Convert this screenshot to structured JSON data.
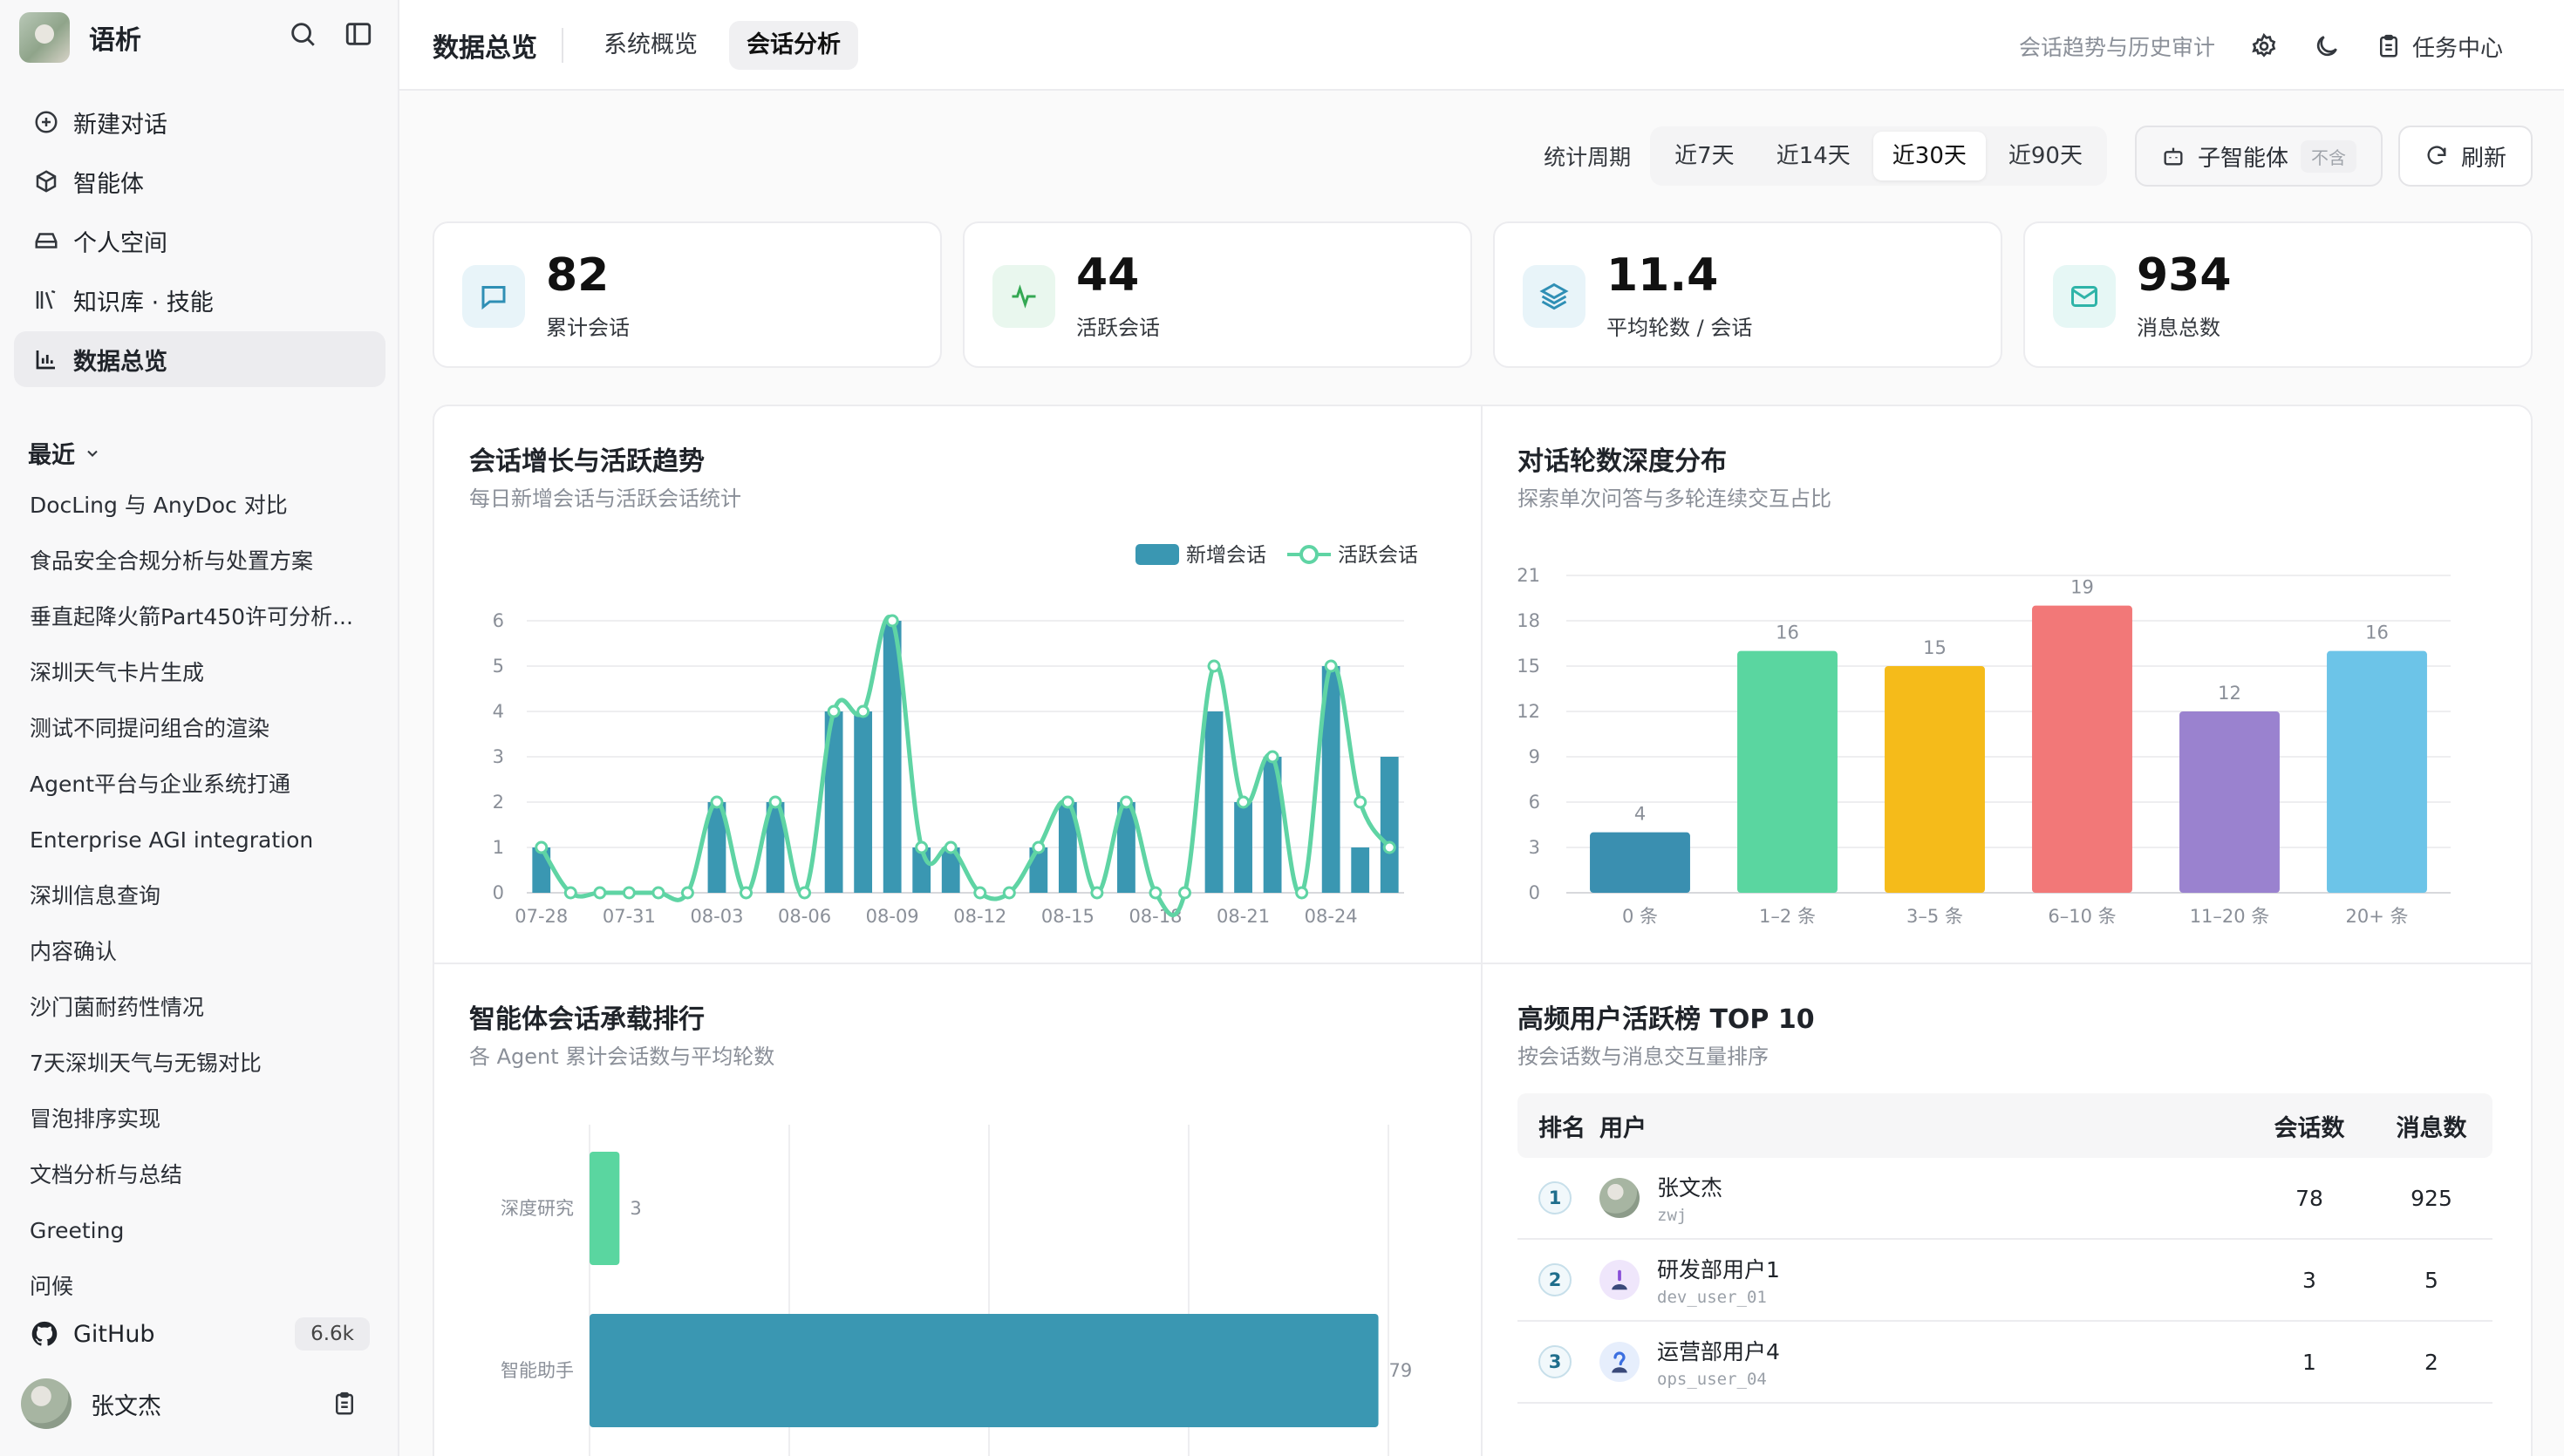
{
  "app": {
    "name": "语析"
  },
  "sidebar": {
    "nav": [
      {
        "label": "新建对话",
        "icon": "plus-circle-icon"
      },
      {
        "label": "智能体",
        "icon": "cube-icon"
      },
      {
        "label": "个人空间",
        "icon": "drive-icon"
      },
      {
        "label": "知识库 · 技能",
        "icon": "library-icon"
      },
      {
        "label": "数据总览",
        "icon": "bar-chart-icon",
        "active": true
      }
    ],
    "recent_label": "最近",
    "recent": [
      "DocLing 与 AnyDoc 对比",
      "食品安全合规分析与处置方案",
      "垂直起降火箭Part450许可分析...",
      "深圳天气卡片生成",
      "测试不同提问组合的渲染",
      "Agent平台与企业系统打通",
      "Enterprise AGI integration",
      "深圳信息查询",
      "内容确认",
      "沙门菌耐药性情况",
      "7天深圳天气与无锡对比",
      "冒泡排序实现",
      "文档分析与总结",
      "Greeting",
      "问候"
    ],
    "github": {
      "label": "GitHub",
      "stars": "6.6k"
    },
    "user": {
      "name": "张文杰"
    }
  },
  "header": {
    "title": "数据总览",
    "tabs": [
      {
        "label": "系统概览",
        "active": false
      },
      {
        "label": "会话分析",
        "active": true
      }
    ],
    "subtitle": "会话趋势与历史审计",
    "task_center": "任务中心"
  },
  "filters": {
    "period_label": "统计周期",
    "periods": [
      {
        "label": "近7天"
      },
      {
        "label": "近14天"
      },
      {
        "label": "近30天",
        "active": true
      },
      {
        "label": "近90天"
      }
    ],
    "subagent_label": "子智能体",
    "subagent_tag": "不含",
    "refresh_label": "刷新"
  },
  "kpis": [
    {
      "value": "82",
      "label": "累计会话",
      "icon": "chat-icon",
      "color": "#2f8fb5",
      "bg": "#e8f4f9"
    },
    {
      "value": "44",
      "label": "活跃会话",
      "icon": "activity-icon",
      "color": "#34a853",
      "bg": "#e9f7ee"
    },
    {
      "value": "11.4",
      "label": "平均轮数 / 会话",
      "icon": "layers-icon",
      "color": "#2f8fb5",
      "bg": "#e8f4f9"
    },
    {
      "value": "934",
      "label": "消息总数",
      "icon": "mail-icon",
      "color": "#2fb4a8",
      "bg": "#e6f7f5"
    }
  ],
  "panels": {
    "trend": {
      "title": "会话增长与活跃趋势",
      "subtitle": "每日新增会话与活跃会话统计"
    },
    "depth": {
      "title": "对话轮数深度分布",
      "subtitle": "探索单次问答与多轮连续交互占比"
    },
    "agents": {
      "title": "智能体会话承载排行",
      "subtitle": "各 Agent 累计会话数与平均轮数"
    },
    "users": {
      "title": "高频用户活跃榜 TOP 10",
      "subtitle": "按会话数与消息交互量排序"
    }
  },
  "chart_data": [
    {
      "type": "bar",
      "name": "trend",
      "x": [
        "07-28",
        "07-29",
        "07-30",
        "07-31",
        "08-01",
        "08-02",
        "08-03",
        "08-04",
        "08-05",
        "08-06",
        "08-07",
        "08-08",
        "08-09",
        "08-10",
        "08-11",
        "08-12",
        "08-13",
        "08-14",
        "08-15",
        "08-16",
        "08-17",
        "08-18",
        "08-19",
        "08-20",
        "08-21",
        "08-22",
        "08-23",
        "08-24",
        "08-25",
        "08-26"
      ],
      "xticks": [
        "07-28",
        "07-31",
        "08-03",
        "08-06",
        "08-09",
        "08-12",
        "08-15",
        "08-18",
        "08-21",
        "08-24"
      ],
      "ylim": [
        0,
        6
      ],
      "yticks": [
        0,
        1,
        2,
        3,
        4,
        5,
        6
      ],
      "series": [
        {
          "name": "新增会话",
          "kind": "bar",
          "color": "#3a97b2",
          "values": [
            1,
            0,
            0,
            0,
            0,
            0,
            2,
            0,
            2,
            0,
            4,
            4,
            6,
            1,
            1,
            0,
            0,
            1,
            2,
            0,
            2,
            0,
            0,
            4,
            2,
            3,
            0,
            5,
            1,
            3
          ]
        },
        {
          "name": "活跃会话",
          "kind": "line",
          "color": "#5fd4a4",
          "values": [
            1,
            0,
            0,
            0,
            0,
            0,
            2,
            0,
            2,
            0,
            4,
            4,
            6,
            1,
            1,
            0,
            0,
            1,
            2,
            0,
            2,
            0,
            0,
            5,
            2,
            3,
            0,
            5,
            2,
            1
          ]
        }
      ]
    },
    {
      "type": "bar",
      "name": "depth",
      "categories": [
        "0 条",
        "1–2 条",
        "3–5 条",
        "6–10 条",
        "11–20 条",
        "20+ 条"
      ],
      "values": [
        4,
        16,
        15,
        19,
        12,
        16
      ],
      "colors": [
        "#3a8fb0",
        "#5ad6a0",
        "#f5bb1a",
        "#f27878",
        "#9a82cf",
        "#6cc4e8"
      ],
      "ylim": [
        0,
        21
      ],
      "yticks": [
        0,
        3,
        6,
        9,
        12,
        15,
        18,
        21
      ]
    },
    {
      "type": "bar",
      "name": "agents",
      "orientation": "horizontal",
      "categories": [
        "深度研究",
        "智能助手"
      ],
      "values": [
        3,
        79
      ],
      "colors": [
        "#5ad6a0",
        "#3a97b2"
      ],
      "xlim": [
        0,
        80
      ]
    }
  ],
  "user_table": {
    "headers": {
      "rank": "排名",
      "user": "用户",
      "sessions": "会话数",
      "messages": "消息数"
    },
    "rows": [
      {
        "rank": "1",
        "name": "张文杰",
        "id": "zwj",
        "sessions": "78",
        "messages": "925"
      },
      {
        "rank": "2",
        "name": "研发部用户1",
        "id": "dev_user_01",
        "sessions": "3",
        "messages": "5"
      },
      {
        "rank": "3",
        "name": "运营部用户4",
        "id": "ops_user_04",
        "sessions": "1",
        "messages": "2"
      }
    ]
  }
}
